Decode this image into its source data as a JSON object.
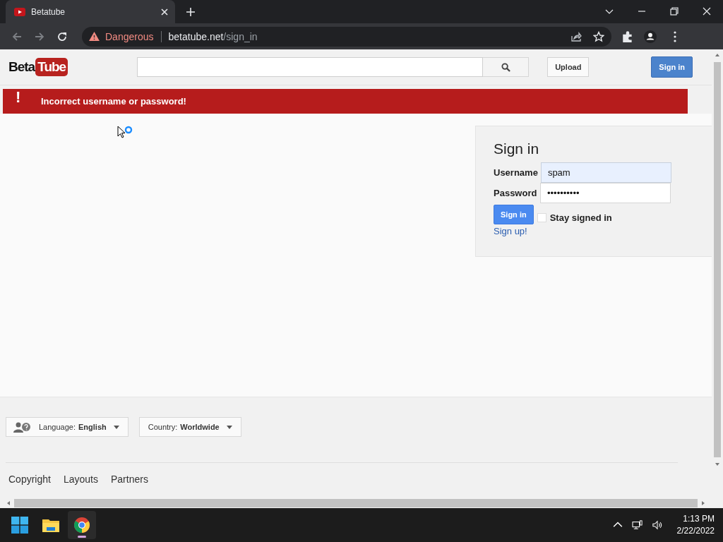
{
  "browser": {
    "tab": {
      "title": "Betatube",
      "selected": true
    },
    "security": "Dangerous",
    "url_host": "betatube.net",
    "url_path": "/sign_in"
  },
  "header": {
    "logo": [
      "Beta",
      "Tube"
    ],
    "upload": "Upload",
    "sign_in": "Sign in"
  },
  "alert": {
    "icon": "!",
    "message": "Incorrect username or password!"
  },
  "sign_in_panel": {
    "title": "Sign in",
    "fields": [
      {
        "label": "Username",
        "value": "spam",
        "autofilled": true
      },
      {
        "label": "Password",
        "value": "••••••••••",
        "autofilled": false
      }
    ],
    "button": "Sign in",
    "stay_signed_in": {
      "label": "Stay signed in",
      "checked": false
    },
    "sign_up": "Sign up!"
  },
  "footer": {
    "selectors": [
      {
        "label": "Language:",
        "value": "English",
        "kind": "language"
      },
      {
        "label": "Country:",
        "value": "Worldwide",
        "kind": "plain"
      }
    ],
    "links": [
      "Copyright",
      "Layouts",
      "Partners"
    ]
  },
  "taskbar": {
    "apps": [
      {
        "kind": "start",
        "selected": false
      },
      {
        "kind": "files",
        "selected": false
      },
      {
        "kind": "chrome",
        "selected": true
      }
    ],
    "time": "1:13 PM",
    "date": "2/22/2022"
  }
}
